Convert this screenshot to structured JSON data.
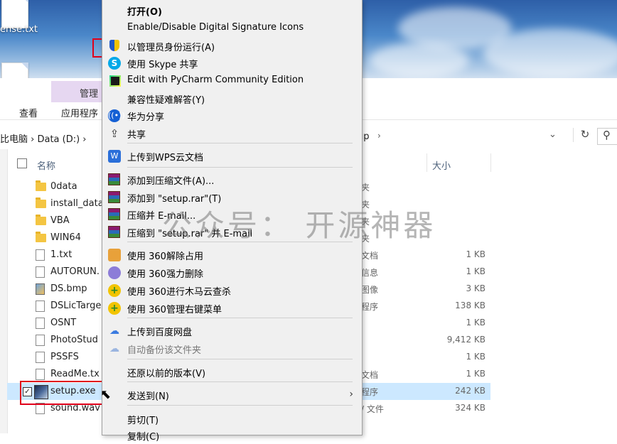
{
  "desktop": {
    "file_label": "ense.txt"
  },
  "explorer": {
    "ribbon": {
      "manage_tab": "管理",
      "view_tab": "查看",
      "app_tools_tab": "应用程序"
    },
    "address": {
      "path": "比电脑  ›  Data (D:)  ›",
      "tail": "up"
    },
    "columns": {
      "name": "名称",
      "size": "大小"
    },
    "files": [
      {
        "name": "0data",
        "type": "夹",
        "size": "",
        "icon": "folder"
      },
      {
        "name": "install_data",
        "type": "夹",
        "size": "",
        "icon": "folder"
      },
      {
        "name": "VBA",
        "type": "夹",
        "size": "",
        "icon": "folder"
      },
      {
        "name": "WIN64",
        "type": "夹",
        "size": "",
        "icon": "folder"
      },
      {
        "name": "1.txt",
        "type": "文档",
        "size": "1 KB",
        "icon": "doc"
      },
      {
        "name": "AUTORUN.",
        "type": "信息",
        "size": "1 KB",
        "icon": "doc"
      },
      {
        "name": "DS.bmp",
        "type": "图像",
        "size": "3 KB",
        "icon": "img"
      },
      {
        "name": "DSLicTarge",
        "type": "程序",
        "size": "138 KB",
        "icon": "doc"
      },
      {
        "name": "OSNT",
        "type": "",
        "size": "1 KB",
        "icon": "doc"
      },
      {
        "name": "PhotoStud",
        "type": "",
        "size": "9,412 KB",
        "icon": "doc"
      },
      {
        "name": "PSSFS",
        "type": "",
        "size": "1 KB",
        "icon": "doc"
      },
      {
        "name": "ReadMe.tx",
        "type": "文档",
        "size": "1 KB",
        "icon": "doc"
      },
      {
        "name": "setup.exe",
        "type": "程序",
        "size": "242 KB",
        "icon": "exe"
      },
      {
        "name": "sound.wav",
        "type": "/ 文件",
        "size": "324 KB",
        "icon": "doc"
      }
    ]
  },
  "context_menu": {
    "items": [
      {
        "label": "打开(O)",
        "icon": "",
        "bold": true
      },
      {
        "label": "Enable/Disable Digital Signature Icons",
        "icon": ""
      },
      {
        "label": "以管理员身份运行(A)",
        "icon": "shield-icon"
      },
      {
        "label": "使用 Skype 共享",
        "icon": "skype-icon"
      },
      {
        "label": "Edit with PyCharm Community Edition",
        "icon": "pycharm-icon"
      },
      {
        "label": "兼容性疑难解答(Y)",
        "icon": ""
      },
      {
        "label": "华为分享",
        "icon": "huawei-share-icon"
      },
      {
        "label": "共享",
        "icon": "share-icon"
      },
      {
        "label": "上传到WPS云文档",
        "icon": "wps-icon"
      },
      {
        "label": "添加到压缩文件(A)...",
        "icon": "rar-icon"
      },
      {
        "label": "添加到 \"setup.rar\"(T)",
        "icon": "rar-icon"
      },
      {
        "label": "压缩并 E-mail...",
        "icon": "rar-icon"
      },
      {
        "label": "压缩到 \"setup.rar\" 并 E-mail",
        "icon": "rar-icon"
      },
      {
        "label": "使用 360解除占用",
        "icon": "360-unlock-icon"
      },
      {
        "label": "使用 360强力删除",
        "icon": "360-delete-icon"
      },
      {
        "label": "使用 360进行木马云查杀",
        "icon": "360-scan-icon"
      },
      {
        "label": "使用 360管理右键菜单",
        "icon": "360-menu-icon"
      },
      {
        "label": "上传到百度网盘",
        "icon": "baidu-icon"
      },
      {
        "label": "自动备份该文件夹",
        "icon": "baidu-icon",
        "disabled": true
      },
      {
        "label": "还原以前的版本(V)",
        "icon": ""
      },
      {
        "label": "发送到(N)",
        "icon": ""
      },
      {
        "label": "剪切(T)",
        "icon": ""
      },
      {
        "label": "复制(C)",
        "icon": ""
      }
    ]
  },
  "watermark": "公众号：  开源神器"
}
